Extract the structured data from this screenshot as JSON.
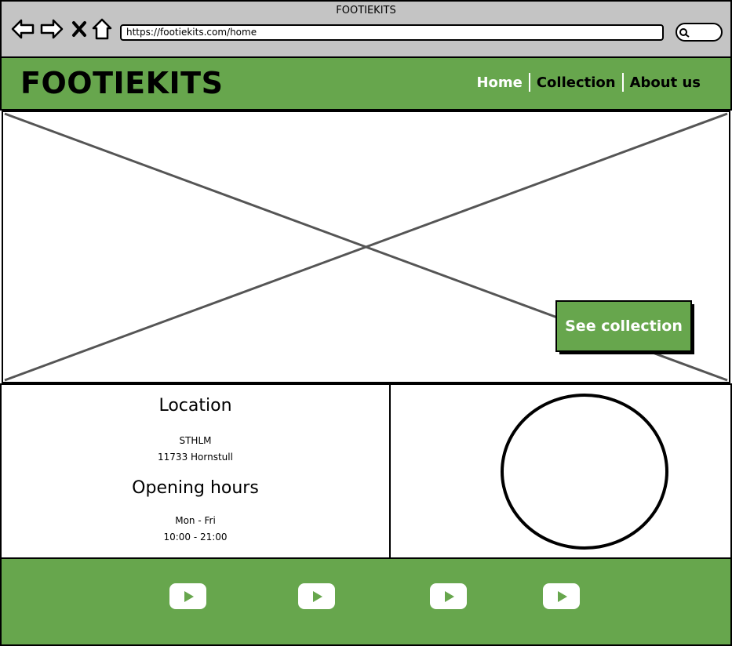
{
  "window": {
    "title": "FOOTIEKITS"
  },
  "browser": {
    "url": "https://footiekits.com/home"
  },
  "header": {
    "logo": "FOOTIEKITS",
    "nav": [
      {
        "label": "Home",
        "active": true
      },
      {
        "label": "Collection",
        "active": false
      },
      {
        "label": "About us",
        "active": false
      }
    ]
  },
  "hero": {
    "cta_label": "See collection"
  },
  "info": {
    "location_heading": "Location",
    "location_line1": "STHLM",
    "location_line2": "11733 Hornstull",
    "hours_heading": "Opening hours",
    "hours_line1": "Mon - Fri",
    "hours_line2": "10:00 - 21:00"
  },
  "footer": {
    "icons": [
      "youtube-icon",
      "youtube-icon",
      "youtube-icon",
      "youtube-icon"
    ]
  },
  "colors": {
    "brand_green": "#67a64d",
    "chrome_gray": "#c4c4c4",
    "nav_active": "#ffffff"
  }
}
